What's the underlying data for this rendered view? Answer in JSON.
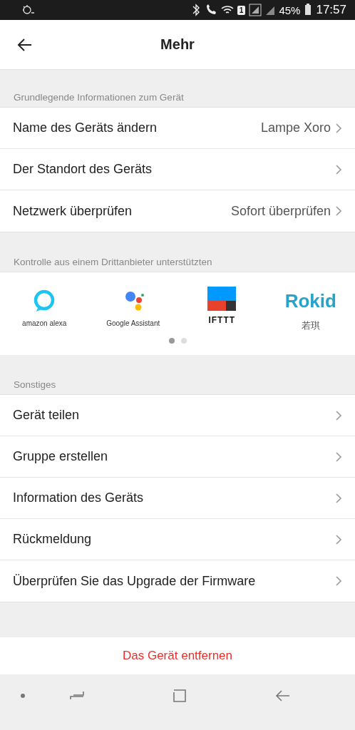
{
  "status_bar": {
    "sim_badge": "1",
    "battery": "45%",
    "time": "17:57"
  },
  "header": {
    "title": "Mehr"
  },
  "sections": [
    {
      "label": "Grundlegende Informationen zum Gerät",
      "rows": [
        {
          "label": "Name des Geräts ändern",
          "value": "Lampe Xoro"
        },
        {
          "label": "Der Standort des Geräts"
        },
        {
          "label": "Netzwerk überprüfen",
          "value": "Sofort überprüfen"
        }
      ]
    },
    {
      "label": "Kontrolle aus einem Drittanbieter unterstützten",
      "partners": [
        {
          "kind": "alexa",
          "name": "amazon alexa"
        },
        {
          "kind": "assistant",
          "name": "Google Assistant"
        },
        {
          "kind": "ifttt",
          "name": "IFTTT"
        },
        {
          "kind": "rokid",
          "logo_text": "Rokid",
          "name": "若琪"
        }
      ],
      "pages": [
        {
          "selected": true
        },
        {
          "selected": false
        }
      ]
    },
    {
      "label": "Sonstiges",
      "rows": [
        {
          "label": "Gerät teilen"
        },
        {
          "label": "Gruppe erstellen"
        },
        {
          "label": "Information des Geräts"
        },
        {
          "label": "Rückmeldung"
        },
        {
          "label": "Überprüfen Sie das Upgrade der Firmware"
        }
      ]
    }
  ],
  "remove_button": "Das Gerät entfernen"
}
